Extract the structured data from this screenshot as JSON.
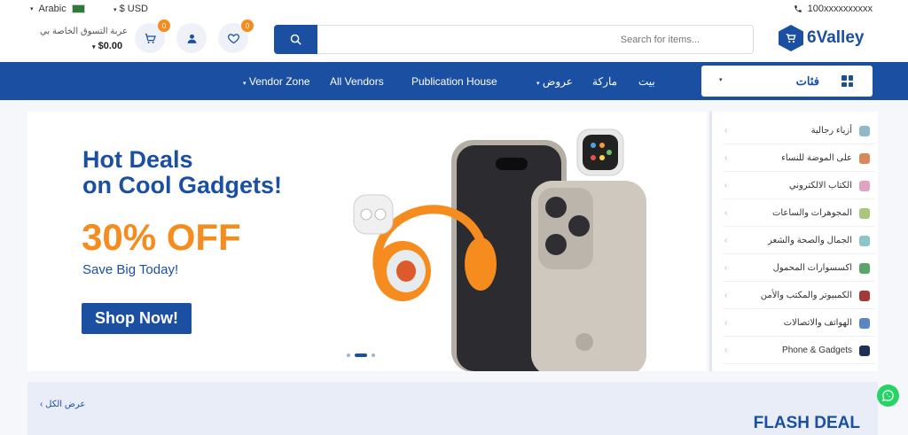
{
  "topbar": {
    "language": "Arabic",
    "currency": "$ USD",
    "phone": "100xxxxxxxxxx"
  },
  "header": {
    "cart_label": "عربة التسوق الخاصة بي",
    "cart_total": "$0.00",
    "cart_count": "0",
    "wishlist_count": "0",
    "search_placeholder": "Search for items...",
    "logo_text": "6Valley"
  },
  "nav": {
    "categories_label": "فئات",
    "items": [
      "Vendor Zone",
      "All Vendors",
      "Publication House",
      "عروض",
      "ماركة",
      "بيت"
    ]
  },
  "hero": {
    "title_line1": "Hot Deals",
    "title_line2": "on Cool Gadgets!",
    "discount": "30% OFF",
    "subtitle": "Save Big Today!",
    "cta": "Shop Now!",
    "slide_active": 2,
    "slide_count": 3
  },
  "sidebar": {
    "categories": [
      {
        "label": "أزياء رجالية",
        "color": "#8fb9c9"
      },
      {
        "label": "على الموضة للنساء",
        "color": "#d98a5c"
      },
      {
        "label": "الكتاب الالكتروني",
        "color": "#e0a3c0"
      },
      {
        "label": "المجوهرات والساعات",
        "color": "#a8c77a"
      },
      {
        "label": "الجمال والصحة والشعر",
        "color": "#8cc6c9"
      },
      {
        "label": "اكسسوارات المحمول",
        "color": "#5aa56a"
      },
      {
        "label": "الكمبيوتر والمكتب والأمن",
        "color": "#a33a3a"
      },
      {
        "label": "الهواتف والاتصالات",
        "color": "#5b86c5"
      },
      {
        "label": "Phone & Gadgets",
        "color": "#1e2f5a"
      }
    ]
  },
  "flash_deal": {
    "title": "FLASH DEAL",
    "view_all": "عرض الكل"
  }
}
